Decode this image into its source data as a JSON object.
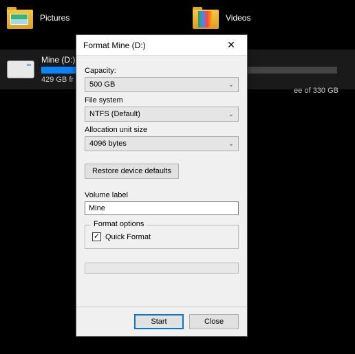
{
  "folders": {
    "pictures_label": "Pictures",
    "videos_label": "Videos"
  },
  "drive": {
    "name": "Mine (D:)",
    "free_text_left": "429 GB fr",
    "free_text_right": "ee of 330 GB",
    "fill_percent": 32
  },
  "dialog": {
    "title": "Format Mine (D:)",
    "capacity_label": "Capacity:",
    "capacity_value": "500 GB",
    "filesystem_label": "File system",
    "filesystem_value": "NTFS (Default)",
    "alloc_label": "Allocation unit size",
    "alloc_value": "4096 bytes",
    "restore_label": "Restore device defaults",
    "volume_label": "Volume label",
    "volume_value": "Mine",
    "format_options_label": "Format options",
    "quick_format_label": "Quick Format",
    "quick_format_checked": true,
    "start_label": "Start",
    "close_label": "Close"
  }
}
